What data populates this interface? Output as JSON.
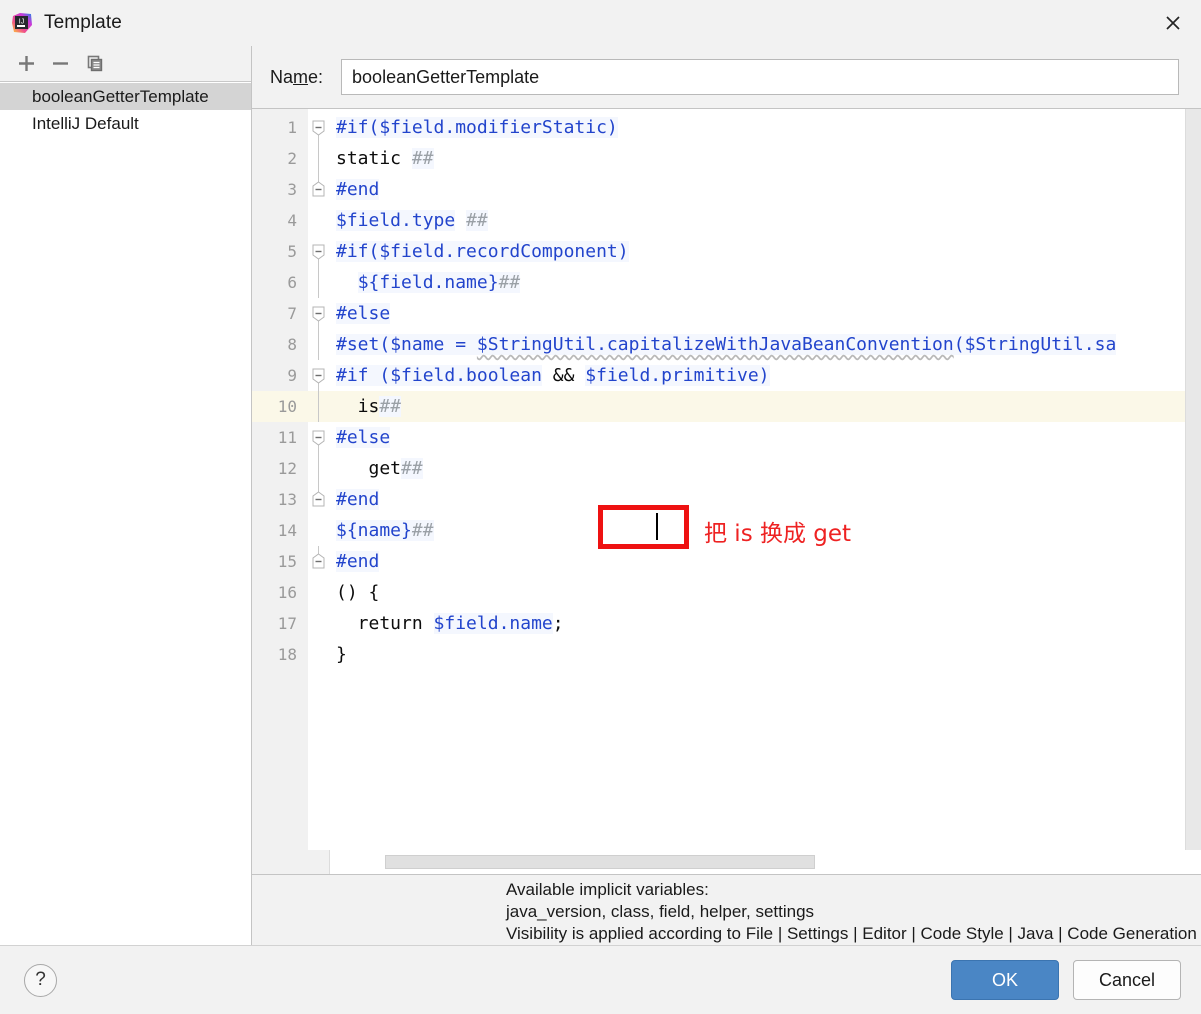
{
  "window": {
    "title": "Template",
    "app_icon": "intellij-idea-icon",
    "close_icon": "close-icon"
  },
  "sidebar": {
    "toolbar": [
      {
        "name": "add-button",
        "icon": "plus-icon",
        "label": "+"
      },
      {
        "name": "remove-button",
        "icon": "minus-icon",
        "label": "−"
      },
      {
        "name": "copy-button",
        "icon": "copy-icon",
        "label": "Copy"
      }
    ],
    "items": [
      {
        "label": "booleanGetterTemplate",
        "selected": true
      },
      {
        "label": "IntelliJ Default",
        "selected": false
      }
    ]
  },
  "name_field": {
    "label_before": "Na",
    "label_mnemonic": "m",
    "label_after": "e:",
    "value": "booleanGetterTemplate",
    "placeholder": ""
  },
  "editor": {
    "lines": [
      {
        "num": "1",
        "current": false,
        "fold": "start",
        "tokens": [
          {
            "t": "#if($field.modifierStatic)",
            "c": "tok-dir"
          }
        ]
      },
      {
        "num": "2",
        "current": false,
        "fold": "mid",
        "tokens": [
          {
            "t": "static ",
            "c": "tok-plain"
          },
          {
            "t": "##",
            "c": "tok-cmt"
          }
        ]
      },
      {
        "num": "3",
        "current": false,
        "fold": "end",
        "tokens": [
          {
            "t": "#end",
            "c": "tok-dir"
          }
        ]
      },
      {
        "num": "4",
        "current": false,
        "fold": "none",
        "tokens": [
          {
            "t": "$field.type",
            "c": "tok-var"
          },
          {
            "t": " ",
            "c": "tok-plain"
          },
          {
            "t": "##",
            "c": "tok-cmt"
          }
        ]
      },
      {
        "num": "5",
        "current": false,
        "fold": "start",
        "tokens": [
          {
            "t": "#if($field.recordComponent)",
            "c": "tok-dir"
          }
        ]
      },
      {
        "num": "6",
        "current": false,
        "fold": "mid",
        "tokens": [
          {
            "t": "  ",
            "c": "tok-plain"
          },
          {
            "t": "${field.name}",
            "c": "tok-var"
          },
          {
            "t": "##",
            "c": "tok-cmt"
          }
        ]
      },
      {
        "num": "7",
        "current": false,
        "fold": "start",
        "tokens": [
          {
            "t": "#else",
            "c": "tok-dir"
          }
        ]
      },
      {
        "num": "8",
        "current": false,
        "fold": "mid",
        "tokens": [
          {
            "t": "#set(",
            "c": "tok-dir"
          },
          {
            "t": "$name",
            "c": "tok-var"
          },
          {
            "t": " = ",
            "c": "tok-dir"
          },
          {
            "t": "$StringUtil.capitalizeWithJavaBeanConvention",
            "c": "tok-wavy"
          },
          {
            "t": "(",
            "c": "tok-dir"
          },
          {
            "t": "$StringUtil",
            "c": "tok-var"
          },
          {
            "t": ".sa",
            "c": "tok-dir"
          }
        ]
      },
      {
        "num": "9",
        "current": false,
        "fold": "start",
        "tokens": [
          {
            "t": "#if (",
            "c": "tok-dir"
          },
          {
            "t": "$field.boolean",
            "c": "tok-var"
          },
          {
            "t": " && ",
            "c": "tok-plain"
          },
          {
            "t": "$field.primitive",
            "c": "tok-var"
          },
          {
            "t": ")",
            "c": "tok-dir"
          }
        ]
      },
      {
        "num": "10",
        "current": true,
        "fold": "mid",
        "tokens": [
          {
            "t": "  is",
            "c": "tok-plain"
          },
          {
            "t": "##",
            "c": "tok-cmt"
          }
        ]
      },
      {
        "num": "11",
        "current": false,
        "fold": "start",
        "tokens": [
          {
            "t": "#else",
            "c": "tok-dir"
          }
        ]
      },
      {
        "num": "12",
        "current": false,
        "fold": "mid",
        "tokens": [
          {
            "t": "   get",
            "c": "tok-plain"
          },
          {
            "t": "##",
            "c": "tok-cmt"
          }
        ]
      },
      {
        "num": "13",
        "current": false,
        "fold": "end",
        "tokens": [
          {
            "t": "#end",
            "c": "tok-dir"
          }
        ]
      },
      {
        "num": "14",
        "current": false,
        "fold": "none",
        "tokens": [
          {
            "t": "${name}",
            "c": "tok-var"
          },
          {
            "t": "##",
            "c": "tok-cmt"
          }
        ]
      },
      {
        "num": "15",
        "current": false,
        "fold": "end",
        "tokens": [
          {
            "t": "#end",
            "c": "tok-dir"
          }
        ]
      },
      {
        "num": "16",
        "current": false,
        "fold": "none",
        "tokens": [
          {
            "t": "() {",
            "c": "tok-plain"
          }
        ]
      },
      {
        "num": "17",
        "current": false,
        "fold": "none",
        "tokens": [
          {
            "t": "  return ",
            "c": "tok-plain"
          },
          {
            "t": "$field.name",
            "c": "tok-var"
          },
          {
            "t": ";",
            "c": "tok-plain"
          }
        ]
      },
      {
        "num": "18",
        "current": false,
        "fold": "none",
        "tokens": [
          {
            "t": "}",
            "c": "tok-plain"
          }
        ]
      }
    ]
  },
  "annotation": {
    "text": "把 is 换成 get",
    "highlight_color": "#ee1111",
    "text_color": "#ee2222"
  },
  "info": {
    "line1": "Available implicit variables:",
    "line2": "java_version, class, field, helper, settings",
    "line3": "Visibility is applied according to File | Settings | Editor | Code Style | Java | Code Generation"
  },
  "footer": {
    "help_label": "?",
    "ok_label": "OK",
    "cancel_label": "Cancel",
    "ok_color": "#4a86c5"
  }
}
